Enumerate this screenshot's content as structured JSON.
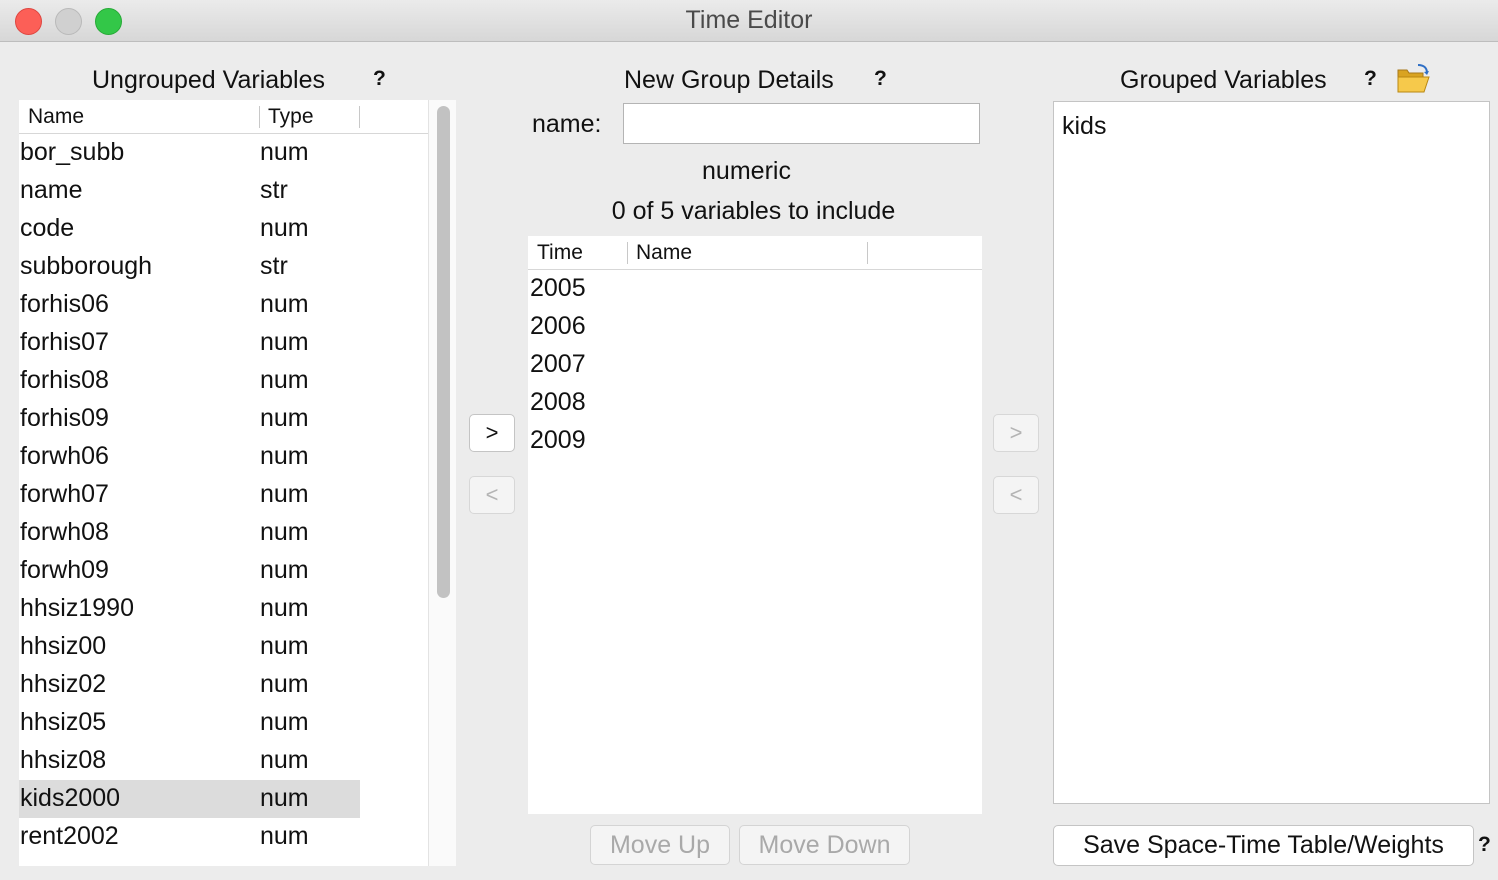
{
  "window": {
    "title": "Time Editor"
  },
  "ungrouped": {
    "title": "Ungrouped Variables",
    "help": "?",
    "columns": [
      "Name",
      "Type"
    ],
    "rows": [
      {
        "name": "bor_subb",
        "type": "num"
      },
      {
        "name": "name",
        "type": "str"
      },
      {
        "name": "code",
        "type": "num"
      },
      {
        "name": "subborough",
        "type": "str"
      },
      {
        "name": "forhis06",
        "type": "num"
      },
      {
        "name": "forhis07",
        "type": "num"
      },
      {
        "name": "forhis08",
        "type": "num"
      },
      {
        "name": "forhis09",
        "type": "num"
      },
      {
        "name": "forwh06",
        "type": "num"
      },
      {
        "name": "forwh07",
        "type": "num"
      },
      {
        "name": "forwh08",
        "type": "num"
      },
      {
        "name": "forwh09",
        "type": "num"
      },
      {
        "name": "hhsiz1990",
        "type": "num"
      },
      {
        "name": "hhsiz00",
        "type": "num"
      },
      {
        "name": "hhsiz02",
        "type": "num"
      },
      {
        "name": "hhsiz05",
        "type": "num"
      },
      {
        "name": "hhsiz08",
        "type": "num"
      },
      {
        "name": "kids2000",
        "type": "num",
        "selected": true
      },
      {
        "name": "rent2002",
        "type": "num"
      }
    ]
  },
  "new_group": {
    "title": "New Group Details",
    "help": "?",
    "name_label": "name:",
    "name_value": "",
    "type_text": "numeric",
    "count_text": "0 of 5 variables to include",
    "columns": [
      "Time",
      "Name"
    ],
    "times": [
      "2005",
      "2006",
      "2007",
      "2008",
      "2009"
    ],
    "move_up_label": "Move Up",
    "move_down_label": "Move Down"
  },
  "buttons": {
    "add_label": ">",
    "remove_label": "<",
    "group_add_label": ">",
    "group_remove_label": "<"
  },
  "grouped": {
    "title": "Grouped Variables",
    "help": "?",
    "items": [
      "kids"
    ],
    "save_label": "Save Space-Time Table/Weights",
    "save_help": "?"
  }
}
